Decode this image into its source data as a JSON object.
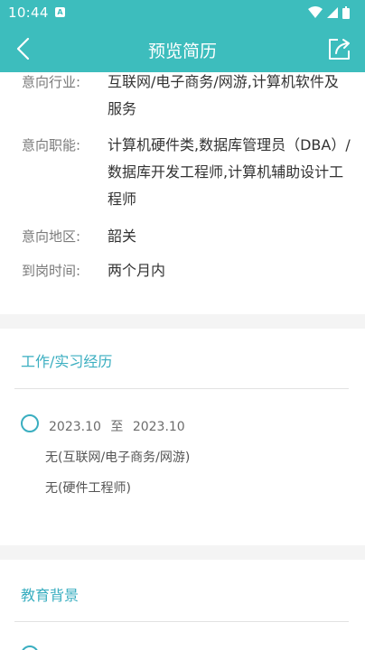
{
  "status_bar": {
    "time": "10:44",
    "notification_badge": "A"
  },
  "nav": {
    "title": "预览简历"
  },
  "job_intent": {
    "rows": [
      {
        "label": "意向行业:",
        "value": "互联网/电子商务/网游,计算机软件及服务"
      },
      {
        "label": "意向职能:",
        "value": "计算机硬件类,数据库管理员（DBA）/数据库开发工程师,计算机辅助设计工程师"
      },
      {
        "label": "意向地区:",
        "value": "韶关"
      },
      {
        "label": "到岗时间:",
        "value": "两个月内"
      }
    ]
  },
  "work_experience": {
    "title": "工作/实习经历",
    "entries": [
      {
        "start": "2023.10",
        "separator": "至",
        "end": "2023.10",
        "company": "无(互联网/电子商务/网游)",
        "position": "无(硬件工程师)"
      }
    ]
  },
  "education": {
    "title": "教育背景"
  },
  "colors": {
    "header": "#3dbdbd",
    "accent": "#3aaec0",
    "gap": "#f4f4f4"
  },
  "icons": {
    "back": "chevron-left-icon",
    "share": "share-icon",
    "signal": "signal-icon",
    "wifi": "wifi-icon",
    "battery": "battery-icon"
  }
}
